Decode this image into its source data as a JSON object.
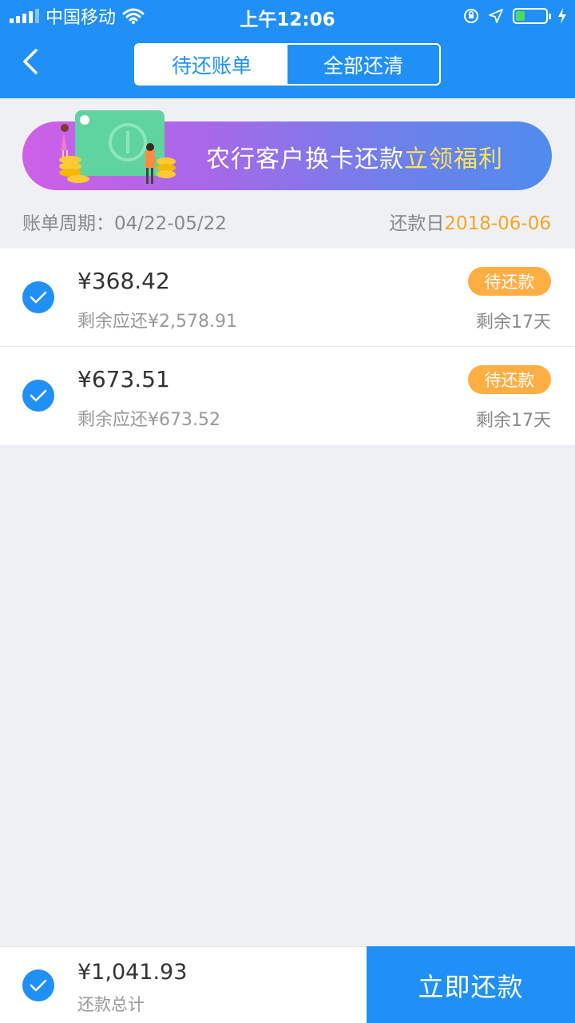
{
  "status_bar": {
    "carrier": "中国移动",
    "time": "上午12:06",
    "battery_level": 0.3
  },
  "nav": {
    "tabs": [
      {
        "label": "待还账单",
        "active": true
      },
      {
        "label": "全部还清",
        "active": false
      }
    ]
  },
  "banner": {
    "text_main": "农行客户换卡还款",
    "text_highlight": "立领福利"
  },
  "bill_period": {
    "label": "账单周期：",
    "range": "04/22-05/22",
    "due_label": "还款日",
    "due_date": "2018-06-06"
  },
  "bills": [
    {
      "amount": "¥368.42",
      "remaining": "剩余应还¥2,578.91",
      "status": "待还款",
      "days_left": "剩余17天",
      "checked": true
    },
    {
      "amount": "¥673.51",
      "remaining": "剩余应还¥673.52",
      "status": "待还款",
      "days_left": "剩余17天",
      "checked": true
    }
  ],
  "footer": {
    "total_amount": "¥1,041.93",
    "total_label": "还款总计",
    "pay_button": "立即还款"
  },
  "colors": {
    "primary": "#2090f6",
    "accent_orange": "#f5a623",
    "badge": "#ffae44",
    "background": "#eef0f4"
  },
  "icons": {
    "back": "chevron-left-icon",
    "check": "check-icon",
    "wifi": "wifi-icon",
    "location": "location-arrow-icon",
    "lock_rotation": "rotation-lock-icon",
    "charging": "bolt-icon"
  }
}
